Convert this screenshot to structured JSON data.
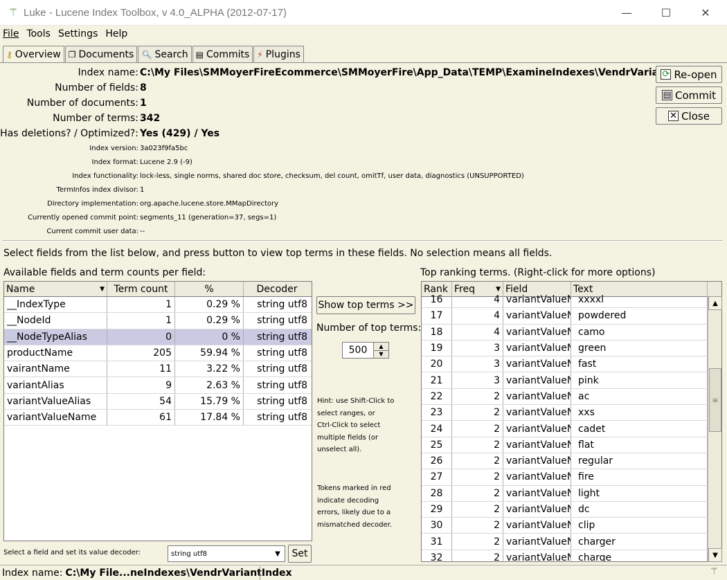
{
  "window": {
    "title": "Luke - Lucene Index Toolbox, v 4.0_ALPHA (2012-07-17)",
    "minimize": "—",
    "maximize": "☐",
    "close": "✕"
  },
  "menu": {
    "file": "File",
    "tools": "Tools",
    "settings": "Settings",
    "help": "Help"
  },
  "tabs": [
    {
      "label": "Overview",
      "icon": "key-icon"
    },
    {
      "label": "Documents",
      "icon": "documents-icon"
    },
    {
      "label": "Search",
      "icon": "search-icon"
    },
    {
      "label": "Commits",
      "icon": "commits-icon"
    },
    {
      "label": "Plugins",
      "icon": "plugins-icon"
    }
  ],
  "overview": {
    "index_name_label": "Index name:",
    "index_name": "C:\\My Files\\SMMoyerFireEcommerce\\SMMoyerFire\\App_Data\\TEMP\\ExamineIndexes\\VendrVariantIndex",
    "num_fields_label": "Number of fields:",
    "num_fields": "8",
    "num_docs_label": "Number of documents:",
    "num_docs": "1",
    "num_terms_label": "Number of terms:",
    "num_terms": "342",
    "deletions_label": "Has deletions? / Optimized?:",
    "deletions": "Yes (429) / Yes",
    "index_version_label": "Index version:",
    "index_version": "3a023f9fa5bc",
    "index_format_label": "Index format:",
    "index_format": "Lucene 2.9 (-9)",
    "functionality_label": "Index functionality:",
    "functionality": "lock-less, single norms, shared doc store, checksum, del count, omitTf, user data, diagnostics (UNSUPPORTED)",
    "terminfos_label": "TermInfos index divisor:",
    "terminfos": "1",
    "directory_label": "Directory implementation:",
    "directory": "org.apache.lucene.store.MMapDirectory",
    "commit_point_label": "Currently opened commit point:",
    "commit_point": "segments_11 (generation=37, segs=1)",
    "commit_userdata_label": "Current commit user data:",
    "commit_userdata": "--"
  },
  "buttons": {
    "reopen": "Re-open",
    "commit": "Commit",
    "close": "Close",
    "show_top_terms": "Show top terms >>",
    "set": "Set"
  },
  "instructions": "Select fields from the list below, and press button to view top terms in these fields. No selection means all fields.",
  "fields_panel": {
    "title": "Available fields and term counts per field:",
    "columns": [
      "Name",
      "Term count",
      "%",
      "Decoder"
    ],
    "rows": [
      {
        "name": "__IndexType",
        "count": "1",
        "pct": "0.29 %",
        "decoder": "string utf8"
      },
      {
        "name": "__NodeId",
        "count": "1",
        "pct": "0.29 %",
        "decoder": "string utf8"
      },
      {
        "name": "__NodeTypeAlias",
        "count": "0",
        "pct": "0 %",
        "decoder": "string utf8"
      },
      {
        "name": "productName",
        "count": "205",
        "pct": "59.94 %",
        "decoder": "string utf8"
      },
      {
        "name": "vairantName",
        "count": "11",
        "pct": "3.22 %",
        "decoder": "string utf8"
      },
      {
        "name": "variantAlias",
        "count": "9",
        "pct": "2.63 %",
        "decoder": "string utf8"
      },
      {
        "name": "variantValueAlias",
        "count": "54",
        "pct": "15.79 %",
        "decoder": "string utf8"
      },
      {
        "name": "variantValueName",
        "count": "61",
        "pct": "17.84 %",
        "decoder": "string utf8"
      }
    ]
  },
  "middle": {
    "num_top_terms_label": "Number of top terms:",
    "num_top_terms": "500",
    "hint": "Hint: use Shift-Click to\nselect ranges, or\nCtrl-Click to select\nmultiple fields (or\nunselect all).",
    "tokens_note": "Tokens marked in red\nindicate decoding\nerrors, likely due to a\nmismatched decoder."
  },
  "terms_panel": {
    "title": "Top ranking terms. (Right-click for more options)",
    "columns": [
      "Rank",
      "Freq",
      "Field",
      "Text"
    ],
    "rows": [
      {
        "rank": "16",
        "freq": "4",
        "field": "variantValueN",
        "text": "xxxxl"
      },
      {
        "rank": "17",
        "freq": "4",
        "field": "variantValueN",
        "text": "powdered"
      },
      {
        "rank": "18",
        "freq": "4",
        "field": "variantValueN",
        "text": "camo"
      },
      {
        "rank": "19",
        "freq": "3",
        "field": "variantValueN",
        "text": "green"
      },
      {
        "rank": "20",
        "freq": "3",
        "field": "variantValueN",
        "text": "fast"
      },
      {
        "rank": "21",
        "freq": "3",
        "field": "variantValueN",
        "text": "pink"
      },
      {
        "rank": "22",
        "freq": "2",
        "field": "variantValueN",
        "text": "ac"
      },
      {
        "rank": "23",
        "freq": "2",
        "field": "variantValueN",
        "text": "xxs"
      },
      {
        "rank": "24",
        "freq": "2",
        "field": "variantValueN",
        "text": "cadet"
      },
      {
        "rank": "25",
        "freq": "2",
        "field": "variantValueN",
        "text": "flat"
      },
      {
        "rank": "26",
        "freq": "2",
        "field": "variantValueN",
        "text": "regular"
      },
      {
        "rank": "27",
        "freq": "2",
        "field": "variantValueN",
        "text": "fire"
      },
      {
        "rank": "28",
        "freq": "2",
        "field": "variantValueN",
        "text": "light"
      },
      {
        "rank": "29",
        "freq": "2",
        "field": "variantValueN",
        "text": "dc"
      },
      {
        "rank": "30",
        "freq": "2",
        "field": "variantValueN",
        "text": "clip"
      },
      {
        "rank": "31",
        "freq": "2",
        "field": "variantValueN",
        "text": "charger"
      },
      {
        "rank": "32",
        "freq": "2",
        "field": "variantValueN",
        "text": "charge"
      }
    ]
  },
  "decoder": {
    "label": "Select a field and set its value decoder:",
    "value": "string utf8"
  },
  "status": {
    "label": "Index name:",
    "value": "C:\\My File...neIndexes\\VendrVariantIndex"
  }
}
